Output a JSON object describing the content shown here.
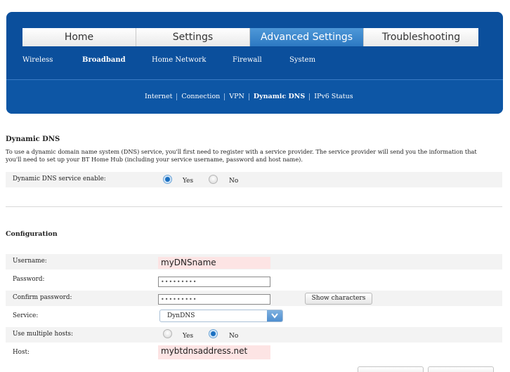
{
  "main_tabs": [
    {
      "label": "Home"
    },
    {
      "label": "Settings"
    },
    {
      "label": "Advanced Settings"
    },
    {
      "label": "Troubleshooting"
    }
  ],
  "sub_nav": [
    {
      "label": "Wireless"
    },
    {
      "label": "Broadband"
    },
    {
      "label": "Home Network"
    },
    {
      "label": "Firewall"
    },
    {
      "label": "System"
    }
  ],
  "tertiary_nav": [
    {
      "label": "Internet"
    },
    {
      "label": "Connection"
    },
    {
      "label": "VPN"
    },
    {
      "label": "Dynamic DNS"
    },
    {
      "label": "IPv6 Status"
    }
  ],
  "dynamic_dns": {
    "title": "Dynamic DNS",
    "description": "To use a dynamic domain name system (DNS) service, you'll first need to register with a service provider. The service provider will send you the information that you'll need to set up your BT Home Hub (including your service username, password and host name).",
    "enable_label": "Dynamic DNS service enable:",
    "yes_label": "Yes",
    "no_label": "No",
    "enabled": true
  },
  "configuration": {
    "title": "Configuration",
    "username_label": "Username:",
    "username_value": "myDNSname",
    "password_label": "Password:",
    "password_value": "•••••••••",
    "confirm_label": "Confirm password:",
    "confirm_value": "•••••••••",
    "show_characters_label": "Show characters",
    "service_label": "Service:",
    "service_value": "DynDNS",
    "multiple_hosts_label": "Use multiple hosts:",
    "multiple_yes_label": "Yes",
    "multiple_no_label": "No",
    "multiple_hosts": false,
    "host_label": "Host:",
    "host_value": "mybtdnsaddress.net"
  },
  "colors": {
    "header_blue": "#0b4f9c",
    "active_tab": "#2d79c2",
    "highlight_field": "#fde4e4"
  }
}
